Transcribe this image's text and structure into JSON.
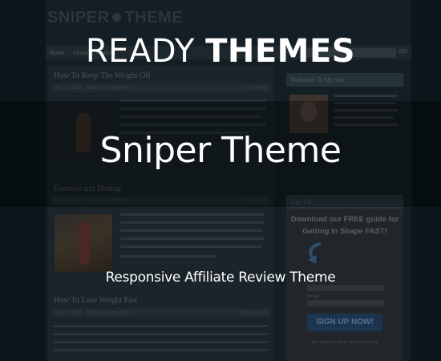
{
  "background_site": {
    "logo": {
      "left": "SNIPER",
      "right": "THEME"
    },
    "nav_items": [
      "Home",
      "About",
      "Contact"
    ],
    "search_button": "GO",
    "posts": [
      {
        "title": "How To Keep The Weight Off",
        "meta": "May 18, 2011  ·  Posted by: blogadmin",
        "comments": "2 Comments"
      },
      {
        "title": "Exercise and Dieting",
        "meta": "May 18, 2011  ·  Posted by: blogadmin",
        "comments": "4 Comments"
      },
      {
        "title": "How To Lose Weight Fast",
        "meta": "May 18, 2011  ·  Posted by: blogadmin",
        "comments": "No Comments"
      }
    ],
    "sidebar": {
      "welcome_heading": "Welcome To My Site",
      "signup_heading": "Sign Up",
      "guide_text": "Download our FREE guide for Getting In Shape FAST!",
      "name_label": "Name:",
      "email_label": "Email:",
      "signup_button": "SIGN UP NOW!",
      "respect_text": "We respect your email privacy"
    }
  },
  "overlay": {
    "brand_light": "READY",
    "brand_bold": "THEMES",
    "title": "Sniper Theme",
    "subtitle": "Responsive Affiliate Review Theme"
  },
  "colors": {
    "background": "#0b1419",
    "overlay_text": "#ffffff",
    "signup_button": "#1d3450"
  }
}
